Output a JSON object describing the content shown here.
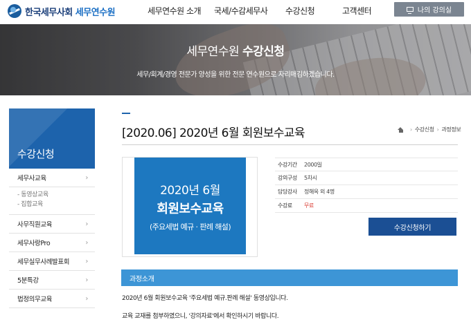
{
  "header": {
    "logo_text": "한국세무사회",
    "logo_sub": "세무연수원",
    "nav": [
      "세무연수원 소개",
      "국세/수감세무사",
      "수강신청",
      "고객센터"
    ],
    "my_class_label": "나의 강의실"
  },
  "banner": {
    "title_prefix": "세무연수원",
    "title_bold": "수강신청",
    "description": "세무/회계/경영 전문가 양성을 위한 전문 연수원으로 자리매김하겠습니다."
  },
  "sidebar": {
    "title": "수강신청",
    "items": [
      {
        "label": "세무사교육",
        "sub": [
          "- 동영상교육",
          "- 집합교육"
        ]
      },
      {
        "label": "사무직원교육"
      },
      {
        "label": "세무사랑Pro"
      },
      {
        "label": "세무실무사례발표회"
      },
      {
        "label": "5분특강"
      },
      {
        "label": "법정의무교육"
      }
    ]
  },
  "breadcrumb": [
    "수강신청",
    "과정정보"
  ],
  "course": {
    "title": "[2020.06] 2020년 6월 회원보수교육",
    "thumbnail": {
      "line1": "2020년 6월",
      "line2": "회원보수교육",
      "line3": "(주요세법 예규 · 판례 해설)"
    },
    "info": [
      {
        "key": "수강기간",
        "value": "2000일"
      },
      {
        "key": "강의구성",
        "value": "5차시"
      },
      {
        "key": "담당강사",
        "value": "정해옥 외 4명"
      },
      {
        "key": "수강료",
        "value": "무료"
      }
    ],
    "apply_label": "수강신청하기"
  },
  "intro": {
    "title": "과정소개",
    "lines": [
      "2020년 6월 회원보수교육 '주요세법 예규.판례 해설' 동영상입니다.",
      "교육 교재를 첨부하였으니, '강의자료'에서 확인하시기 바랍니다."
    ]
  },
  "colors": {
    "brand": "#1d63ac",
    "button": "#1b4f94",
    "intro_bar": "#3d95d6",
    "price": "#d9372e"
  }
}
